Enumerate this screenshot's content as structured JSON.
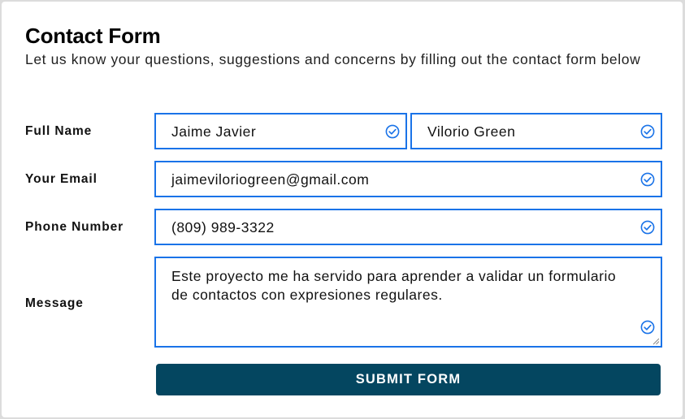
{
  "form": {
    "title": "Contact Form",
    "subtitle": "Let us know your questions, suggestions and concerns by filling out the contact form below",
    "labels": {
      "full_name": "Full Name",
      "email": "Your Email",
      "phone": "Phone Number",
      "message": "Message"
    },
    "values": {
      "first_name": "Jaime Javier",
      "last_name": "Vilorio Green",
      "email": "jaimeviloriogreen@gmail.com",
      "phone": "(809) 989-3322",
      "message": "Este proyecto me ha servido para aprender a validar un formulario de contactos con expresiones regulares."
    },
    "submit_label": "SUBMIT FORM"
  },
  "colors": {
    "accent": "#1a73e8",
    "button": "#044660",
    "page_bg": "#dcdcdc"
  },
  "icons": {
    "valid": "check-circle-icon"
  }
}
